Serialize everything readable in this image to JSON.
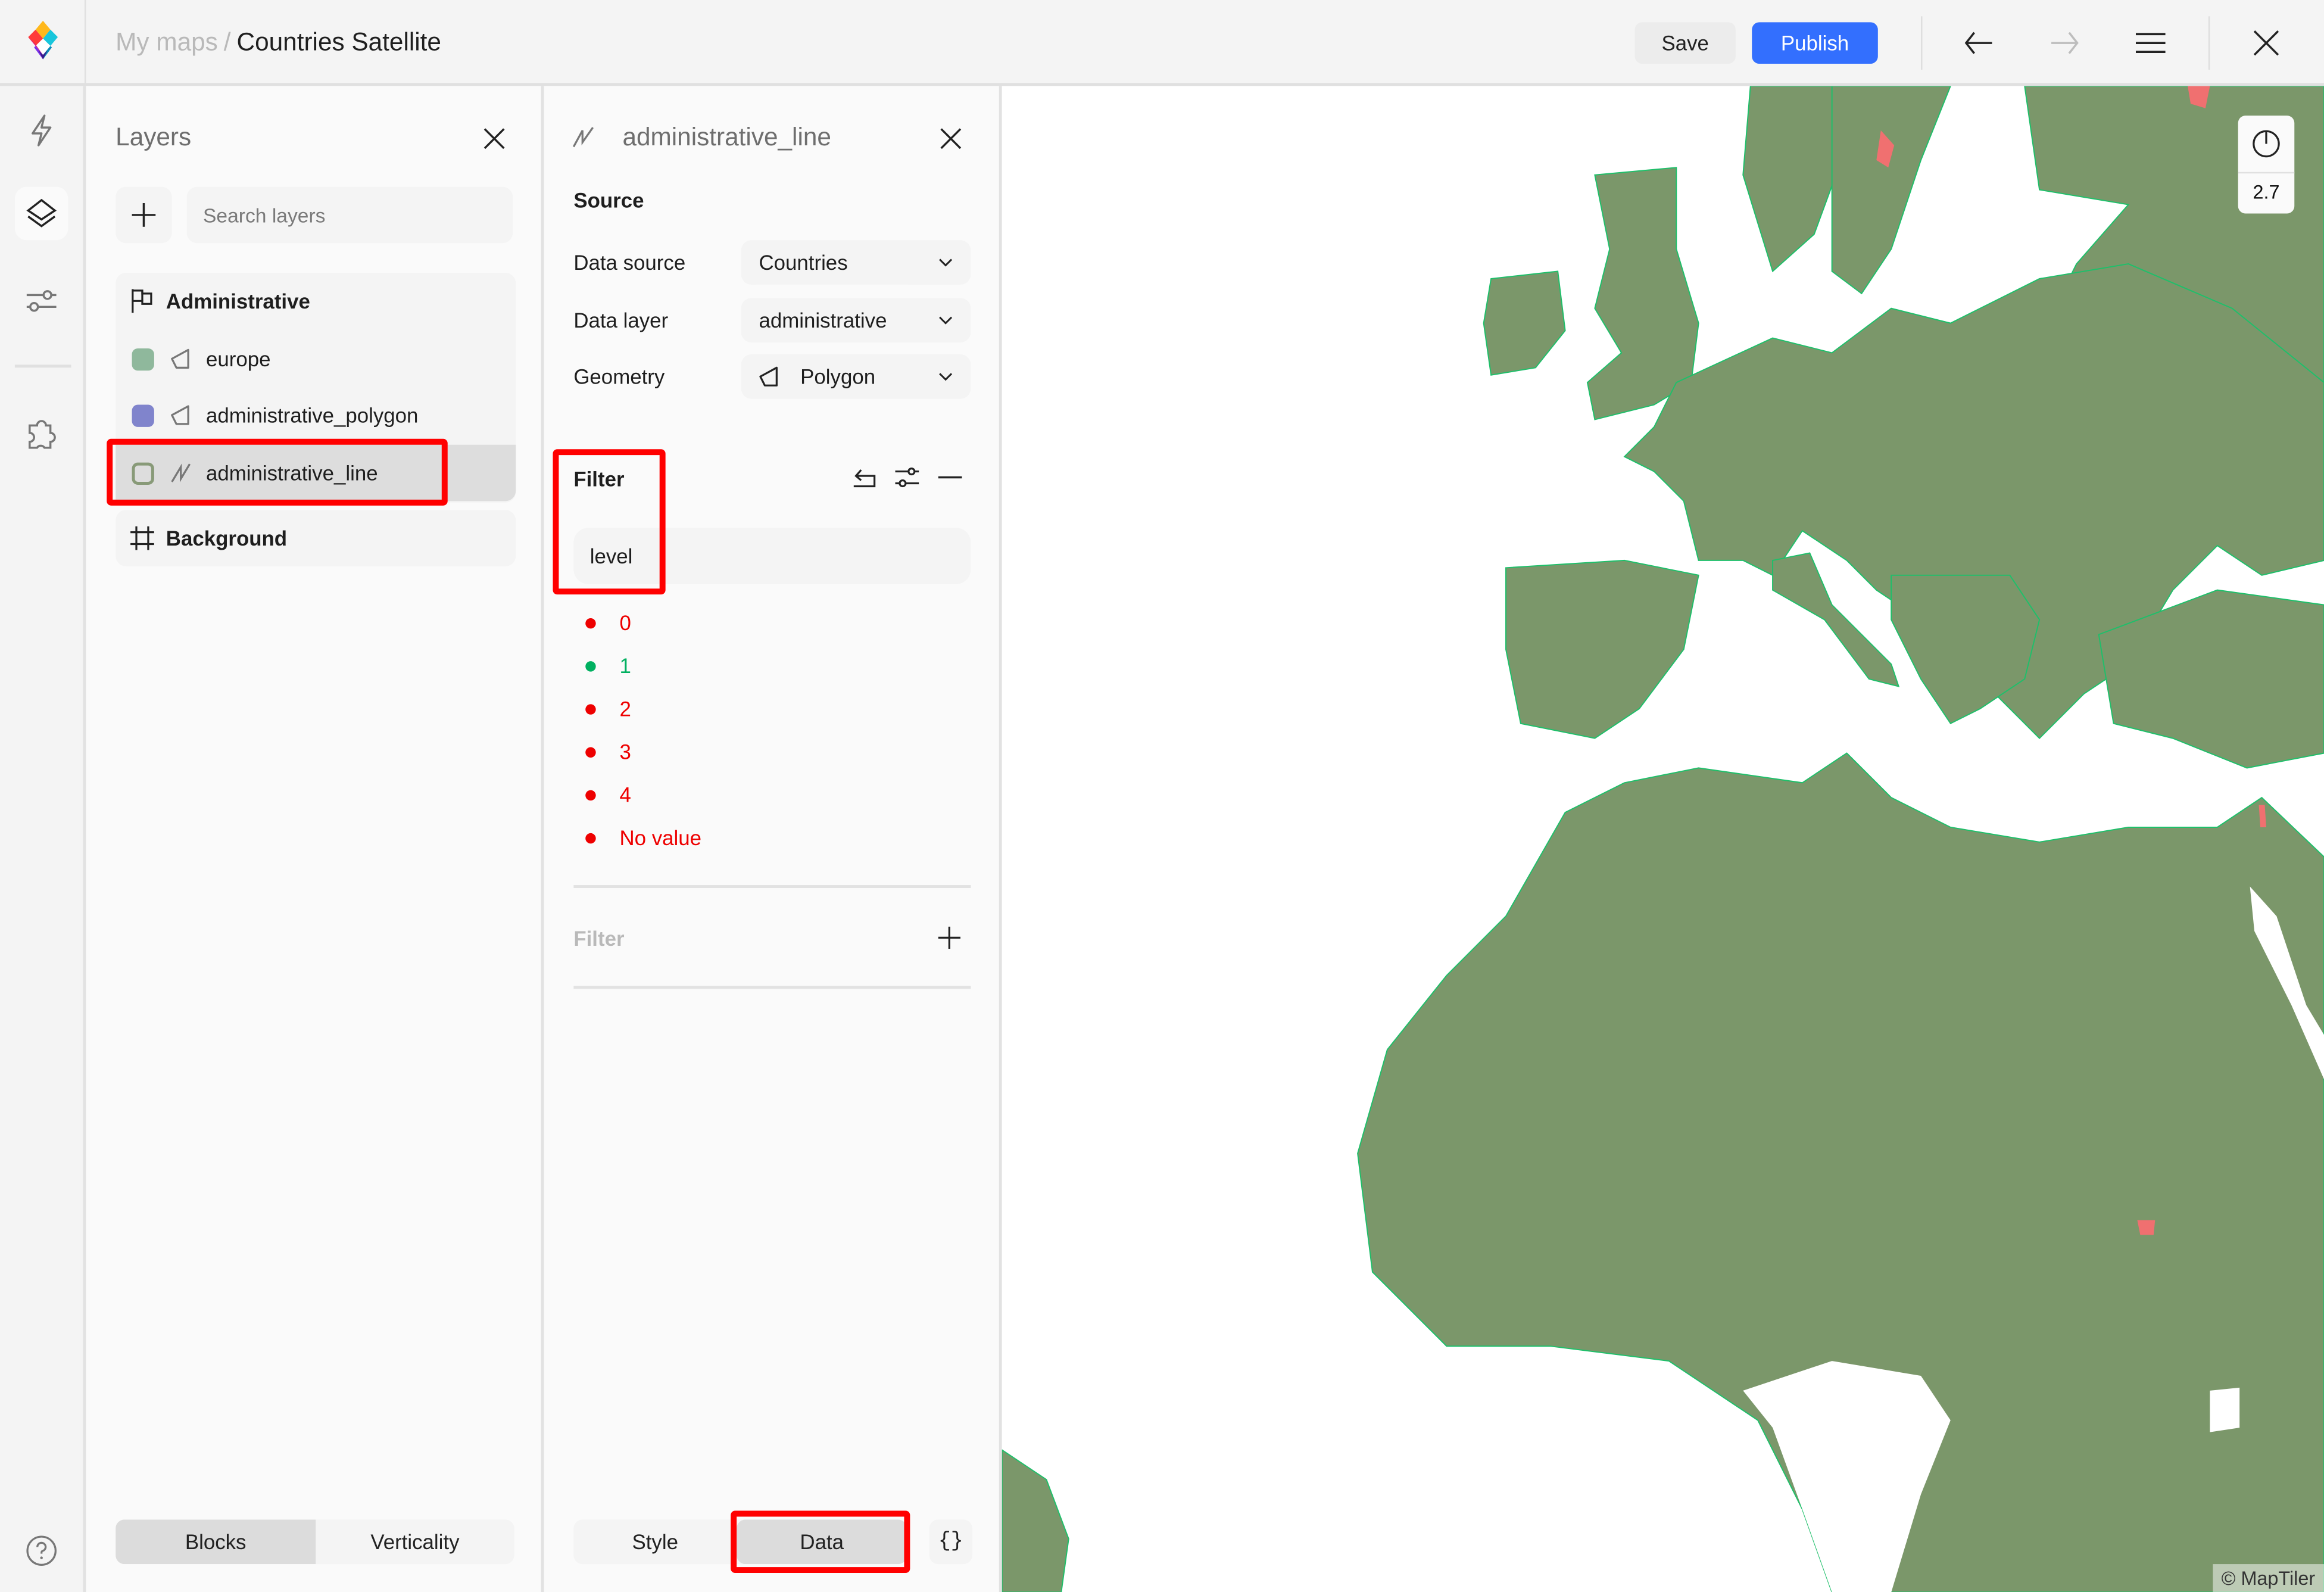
{
  "header": {
    "breadcrumb_root": "My maps",
    "breadcrumb_sep": "/",
    "map_title": "Countries Satellite",
    "save_label": "Save",
    "publish_label": "Publish",
    "accent_color": "#336ffe",
    "icons": [
      "maptiler-logo-icon",
      "undo-arrow-left-icon",
      "redo-arrow-right-icon",
      "hamburger-menu-icon",
      "close-icon"
    ]
  },
  "rail": {
    "items": [
      {
        "name": "quick-actions",
        "icon": "lightning-icon",
        "active": false
      },
      {
        "name": "layers",
        "icon": "layers-icon",
        "active": true
      },
      {
        "name": "settings",
        "icon": "sliders-icon",
        "active": false
      },
      {
        "name": "plugins",
        "icon": "puzzle-icon",
        "active": false
      }
    ],
    "help_icon": "help-circle-icon"
  },
  "layers_panel": {
    "title": "Layers",
    "search_placeholder": "Search layers",
    "groups": [
      {
        "name": "Administrative",
        "icon": "flag-icon",
        "layers": [
          {
            "name": "europe",
            "geometry": "polygon",
            "color": "#8fb89c",
            "selected": false
          },
          {
            "name": "administrative_polygon",
            "geometry": "polygon",
            "color": "#8084cc",
            "selected": false
          },
          {
            "name": "administrative_line",
            "geometry": "line",
            "color": "#889a78",
            "selected": true
          }
        ]
      },
      {
        "name": "Background",
        "icon": "frame-hash-icon",
        "layers": []
      }
    ],
    "bottom_tabs": [
      {
        "label": "Blocks",
        "active": true
      },
      {
        "label": "Verticality",
        "active": false
      }
    ]
  },
  "editor_panel": {
    "layer_name": "administrative_line",
    "source_heading": "Source",
    "fields": [
      {
        "label": "Data source",
        "value": "Countries"
      },
      {
        "label": "Data layer",
        "value": "administrative"
      },
      {
        "label": "Geometry",
        "value": "Polygon",
        "icon": "polygon-icon"
      }
    ],
    "filter_heading": "Filter",
    "filter_field": "level",
    "filter_values": [
      {
        "label": "0",
        "state": "excluded",
        "color": "#ee0000"
      },
      {
        "label": "1",
        "state": "included",
        "color": "#00b060"
      },
      {
        "label": "2",
        "state": "excluded",
        "color": "#ee0000"
      },
      {
        "label": "3",
        "state": "excluded",
        "color": "#ee0000"
      },
      {
        "label": "4",
        "state": "excluded",
        "color": "#ee0000"
      },
      {
        "label": "No value",
        "state": "excluded",
        "color": "#ee0000"
      }
    ],
    "add_filter_label": "Filter",
    "bottom_tabs": [
      {
        "label": "Style",
        "active": false
      },
      {
        "label": "Data",
        "active": true
      }
    ],
    "json_button": "{}"
  },
  "map": {
    "zoom_level": "2.7",
    "attribution": "© MapTiler",
    "land_color": "#7b976a",
    "border_color": "#1fbf6a",
    "highlight_color": "#f07070"
  }
}
